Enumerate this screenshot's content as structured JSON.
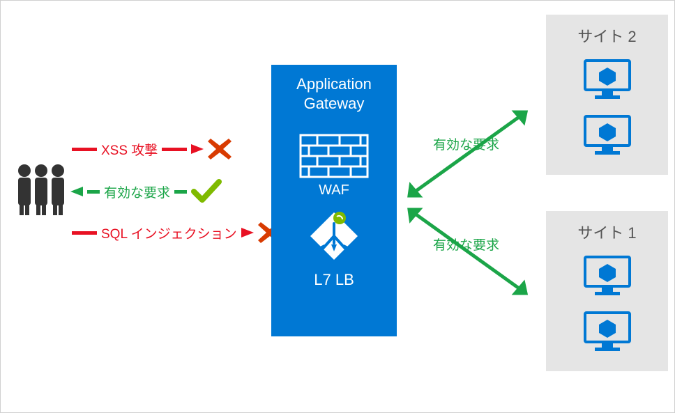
{
  "attacks": {
    "xss": "XSS 攻撃",
    "valid_response": "有効な要求",
    "sql_injection": "SQL インジェクション"
  },
  "gateway": {
    "title_line1": "Application",
    "title_line2": "Gateway",
    "waf_label": "WAF",
    "lb_label": "L7 LB"
  },
  "right_requests": {
    "to_site2": "有効な要求",
    "to_site1": "有効な要求"
  },
  "sites": {
    "site2_title": "サイト 2",
    "site1_title": "サイト 1"
  },
  "colors": {
    "azure_blue": "#0078D4",
    "red": "#E81123",
    "red_x": "#D83B01",
    "green": "#1BA548",
    "light_green": "#7FBA00",
    "gray_panel": "#e5e5e5",
    "dark_gray": "#333333"
  },
  "icons": {
    "people": "people-icon",
    "x_block": "x-block-icon",
    "check": "checkmark-icon",
    "arrow_right_red": "arrow-right-red-icon",
    "arrow_left_green": "arrow-left-green-icon",
    "arrow_right_green": "arrow-right-green-icon",
    "firewall": "firewall-icon",
    "load_balancer": "load-balancer-icon",
    "monitor": "monitor-vm-icon"
  }
}
